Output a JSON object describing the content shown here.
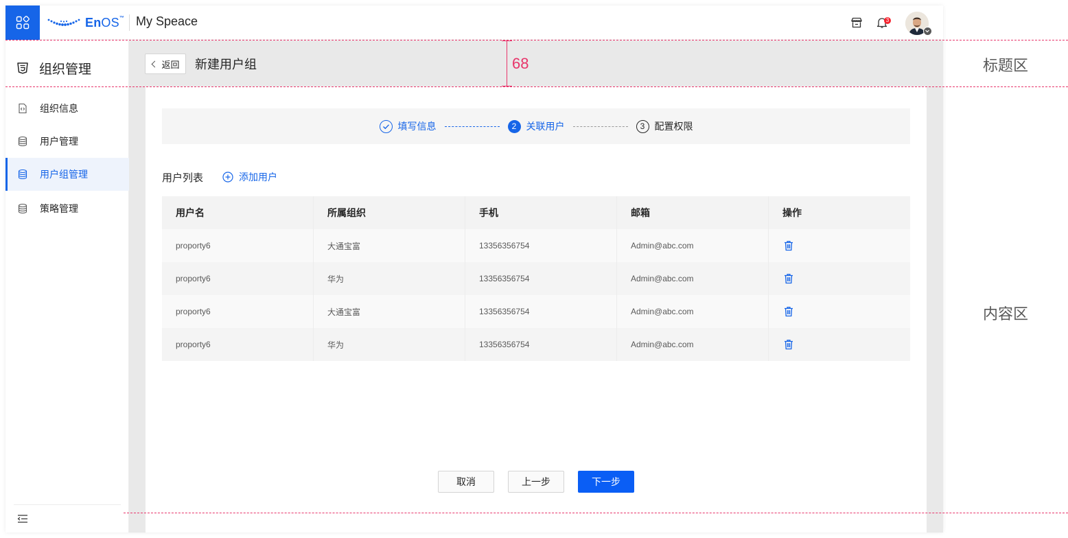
{
  "header": {
    "logo_text_bold": "En",
    "logo_text_light": "OS",
    "logo_tm": "™",
    "app_title": "My Speace",
    "notification_count": "3",
    "icons": [
      "apps-grid-icon",
      "store-icon",
      "bell-icon",
      "user-avatar"
    ]
  },
  "sidebar": {
    "title": "组织管理",
    "items": [
      {
        "label": "组织信息",
        "icon": "file-code-icon",
        "active": false
      },
      {
        "label": "用户管理",
        "icon": "database-icon",
        "active": false
      },
      {
        "label": "用户组管理",
        "icon": "database-icon",
        "active": true
      },
      {
        "label": "策略管理",
        "icon": "database-icon",
        "active": false
      }
    ],
    "collapse_icon": "menu-collapse-icon"
  },
  "titlebar": {
    "back_label": "返回",
    "page_title": "新建用户组"
  },
  "steps": [
    {
      "label": "填写信息",
      "number": "",
      "state": "done"
    },
    {
      "label": "关联用户",
      "number": "2",
      "state": "active"
    },
    {
      "label": "配置权限",
      "number": "3",
      "state": "todo"
    }
  ],
  "list": {
    "title": "用户列表",
    "add_label": "添加用户"
  },
  "table": {
    "columns": [
      "用户名",
      "所属组织",
      "手机",
      "邮箱",
      "操作"
    ],
    "rows": [
      [
        "proporty6",
        "大通宝富",
        "13356356754",
        "Admin@abc.com"
      ],
      [
        "proporty6",
        "华为",
        "13356356754",
        "Admin@abc.com"
      ],
      [
        "proporty6",
        "大通宝富",
        "13356356754",
        "Admin@abc.com"
      ],
      [
        "proporty6",
        "华为",
        "13356356754",
        "Admin@abc.com"
      ]
    ]
  },
  "footer": {
    "cancel_label": "取消",
    "prev_label": "上一步",
    "next_label": "下一步"
  },
  "annotations": {
    "title_height": "68",
    "title_area": "标题区",
    "content_area": "内容区"
  },
  "colors": {
    "primary": "#1665e8",
    "annotation": "#e8346a",
    "danger_badge": "#f5222d"
  }
}
